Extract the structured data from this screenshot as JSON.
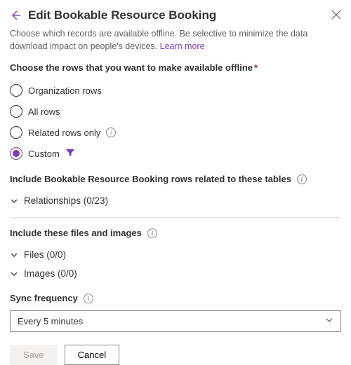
{
  "header": {
    "title": "Edit Bookable Resource Booking",
    "subtext_prefix": "Choose which records are available offline. Be selective to minimize the data download impact on people's devices. ",
    "learn_more": "Learn more"
  },
  "rows_section": {
    "label": "Choose the rows that you want to make available offline",
    "options": {
      "org": "Organization rows",
      "all": "All rows",
      "related": "Related rows only",
      "custom": "Custom"
    },
    "selected": "custom"
  },
  "include_related": {
    "heading": "Include Bookable Resource Booking rows related to these tables",
    "relationships_label": "Relationships (0/23)"
  },
  "files_section": {
    "heading": "Include these files and images",
    "files_label": "Files (0/0)",
    "images_label": "Images (0/0)"
  },
  "sync": {
    "heading": "Sync frequency",
    "value": "Every 5 minutes"
  },
  "footer": {
    "save": "Save",
    "cancel": "Cancel"
  }
}
